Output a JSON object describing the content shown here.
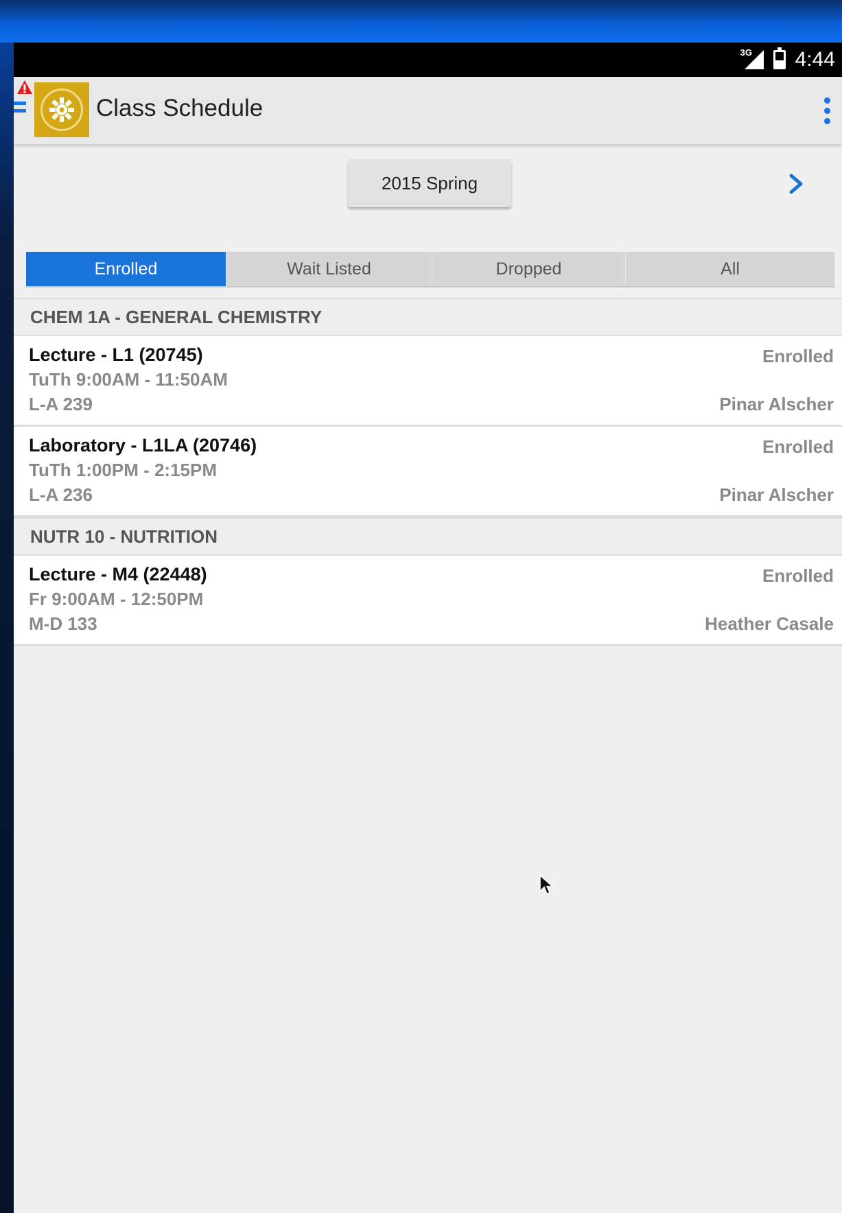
{
  "status_bar": {
    "network": "3G",
    "time": "4:44"
  },
  "app_bar": {
    "title": "Class Schedule"
  },
  "term": {
    "label": "2015 Spring"
  },
  "tabs": [
    {
      "label": "Enrolled",
      "active": true
    },
    {
      "label": "Wait Listed",
      "active": false
    },
    {
      "label": "Dropped",
      "active": false
    },
    {
      "label": "All",
      "active": false
    }
  ],
  "courses": [
    {
      "header": "CHEM 1A - GENERAL CHEMISTRY",
      "sections": [
        {
          "title": "Lecture - L1 (20745)",
          "time": "TuTh 9:00AM - 11:50AM",
          "room": "L-A 239",
          "status": "Enrolled",
          "instructor": "Pinar Alscher"
        },
        {
          "title": "Laboratory - L1LA (20746)",
          "time": "TuTh 1:00PM - 2:15PM",
          "room": "L-A 236",
          "status": "Enrolled",
          "instructor": "Pinar Alscher"
        }
      ]
    },
    {
      "header": "NUTR 10 - NUTRITION",
      "sections": [
        {
          "title": "Lecture - M4 (22448)",
          "time": "Fr 9:00AM - 12:50PM",
          "room": "M-D 133",
          "status": "Enrolled",
          "instructor": "Heather Casale"
        }
      ]
    }
  ],
  "colors": {
    "accent": "#1a73d8",
    "logo_bg": "#d4a815"
  },
  "icons": [
    "menu-icon",
    "alert-icon",
    "overflow-menu-icon",
    "chevron-right-icon",
    "signal-icon",
    "battery-icon"
  ]
}
